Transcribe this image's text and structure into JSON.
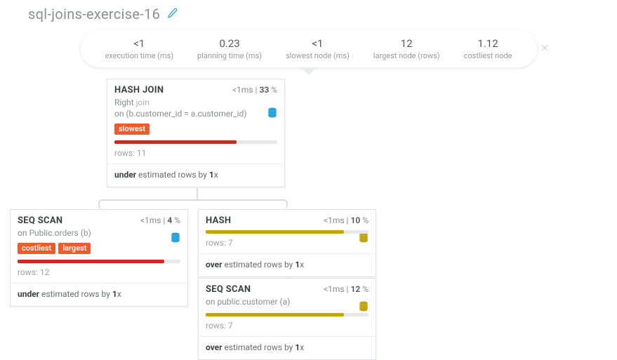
{
  "title": "sql-joins-exercise-16",
  "stats": {
    "exec": {
      "val": "<1",
      "lbl": "execution time (ms)"
    },
    "plan": {
      "val": "0.23",
      "lbl": "planning time (ms)"
    },
    "slow": {
      "val": "<1",
      "lbl": "slowest node (ms)"
    },
    "large": {
      "val": "12",
      "lbl": "largest node (rows)"
    },
    "cost": {
      "val": "1.12",
      "lbl": "costliest node"
    }
  },
  "nodes": {
    "hashjoin": {
      "name": "HASH JOIN",
      "time": "<1",
      "time_unit": "ms",
      "pct": "33",
      "joinword": "join",
      "joinprefix": "Right ",
      "cond": "on (b.customer_id = a.customer_id)",
      "tags": [
        "slowest"
      ],
      "bar_pct": 75,
      "bar_color": "red",
      "rows": "rows: 11",
      "est_prefix": "under",
      "est_mid": " estimated rows by ",
      "est_factor": "1",
      "db_color": "#25a3da"
    },
    "seqscan_orders": {
      "name": "SEQ SCAN",
      "time": "<1",
      "time_unit": "ms",
      "pct": "4",
      "sub": "on Public.orders (b)",
      "tags": [
        "costliest",
        "largest"
      ],
      "bar_pct": 90,
      "bar_color": "red",
      "rows": "rows: 12",
      "est_prefix": "under",
      "est_mid": " estimated rows by ",
      "est_factor": "1",
      "db_color": "#25a3da"
    },
    "hash": {
      "name": "HASH",
      "time": "<1",
      "time_unit": "ms",
      "pct": "10",
      "bar_pct": 85,
      "bar_color": "gold",
      "rows": "rows: 7",
      "est_prefix": "over",
      "est_mid": " estimated rows by ",
      "est_factor": "1",
      "db_color": "#c3a40c"
    },
    "seqscan_customer": {
      "name": "SEQ SCAN",
      "time": "<1",
      "time_unit": "ms",
      "pct": "12",
      "sub": "on public.customer (a)",
      "bar_pct": 85,
      "bar_color": "gold",
      "rows": "rows: 7",
      "est_prefix": "over",
      "est_mid": " estimated rows by ",
      "est_factor": "1",
      "db_color": "#c3a40c"
    }
  },
  "suffix": {
    "x": "x",
    "pct": " %",
    "pipe": " | "
  }
}
